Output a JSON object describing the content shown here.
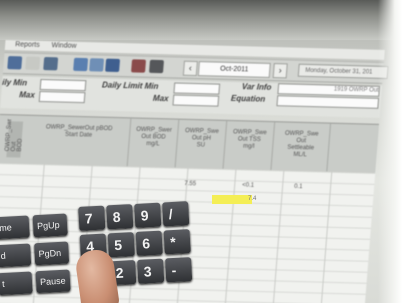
{
  "toolbar": {
    "period": "Oct-2011",
    "date_info": "Monday, October 31, 201"
  },
  "limits": {
    "daily_min_label": "ily Min",
    "max_label_left": "Max",
    "daily_limit_min_label": "Daily Limit Min",
    "max_label_mid": "Max",
    "var_info_label": "Var Info",
    "var_info_value": "1919 OWRP Out",
    "equation_label": "Equation"
  },
  "columns": [
    {
      "label": "OWRP_Swr\nOut\nBOD"
    },
    {
      "label": "OWRP_SewerOut pBOD\nStart Date"
    },
    {
      "label": "OWRP_Swer\nOut BOD\nmg/L"
    },
    {
      "label": "OWRP_Swe\nOut pH\nSU"
    },
    {
      "label": "OWRP_Swe\nOut TSS\nmg/l"
    },
    {
      "label": "OWRP_Swe\nOut\nSettleable\nML/L"
    }
  ],
  "cells": {
    "ph_value": "7.55",
    "tss_value": "<0.1",
    "settle_value": "0.1",
    "highlight_value": "7.4"
  },
  "keypad": {
    "keys": [
      "7",
      "8",
      "9",
      "/",
      "4",
      "5",
      "6",
      "*",
      "1",
      "2",
      "3",
      "-"
    ],
    "func_keys": [
      "me",
      "PgUp",
      "d",
      "PgDn",
      "t",
      "Pause"
    ]
  }
}
